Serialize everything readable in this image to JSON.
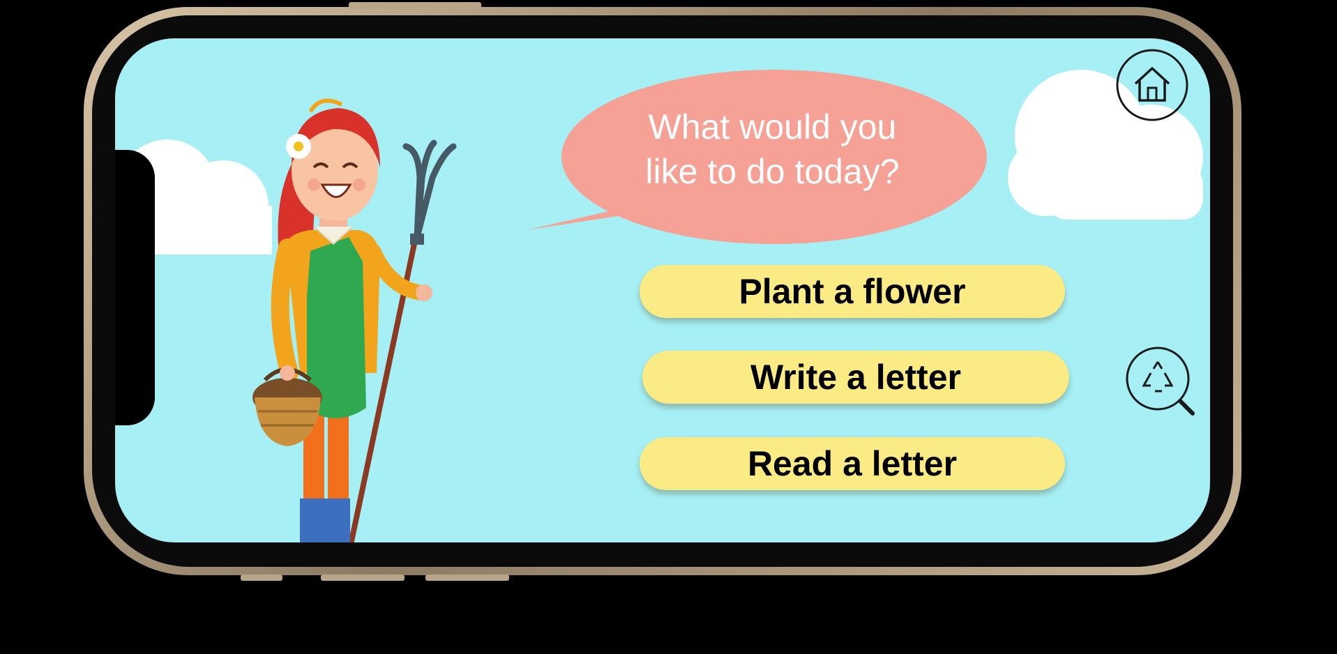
{
  "prompt": {
    "line1": "What would you",
    "line2": "like to do today?"
  },
  "actions": [
    {
      "label": "Plant a flower"
    },
    {
      "label": "Write a letter"
    },
    {
      "label": "Read a letter"
    }
  ],
  "icons": {
    "home": "home-icon",
    "recycle_search": "recycle-search-icon"
  },
  "colors": {
    "sky": "#a6f0f5",
    "bubble": "#f6a195",
    "button": "#faeb84",
    "button_text": "#000000",
    "bubble_text": "#ffffff"
  }
}
